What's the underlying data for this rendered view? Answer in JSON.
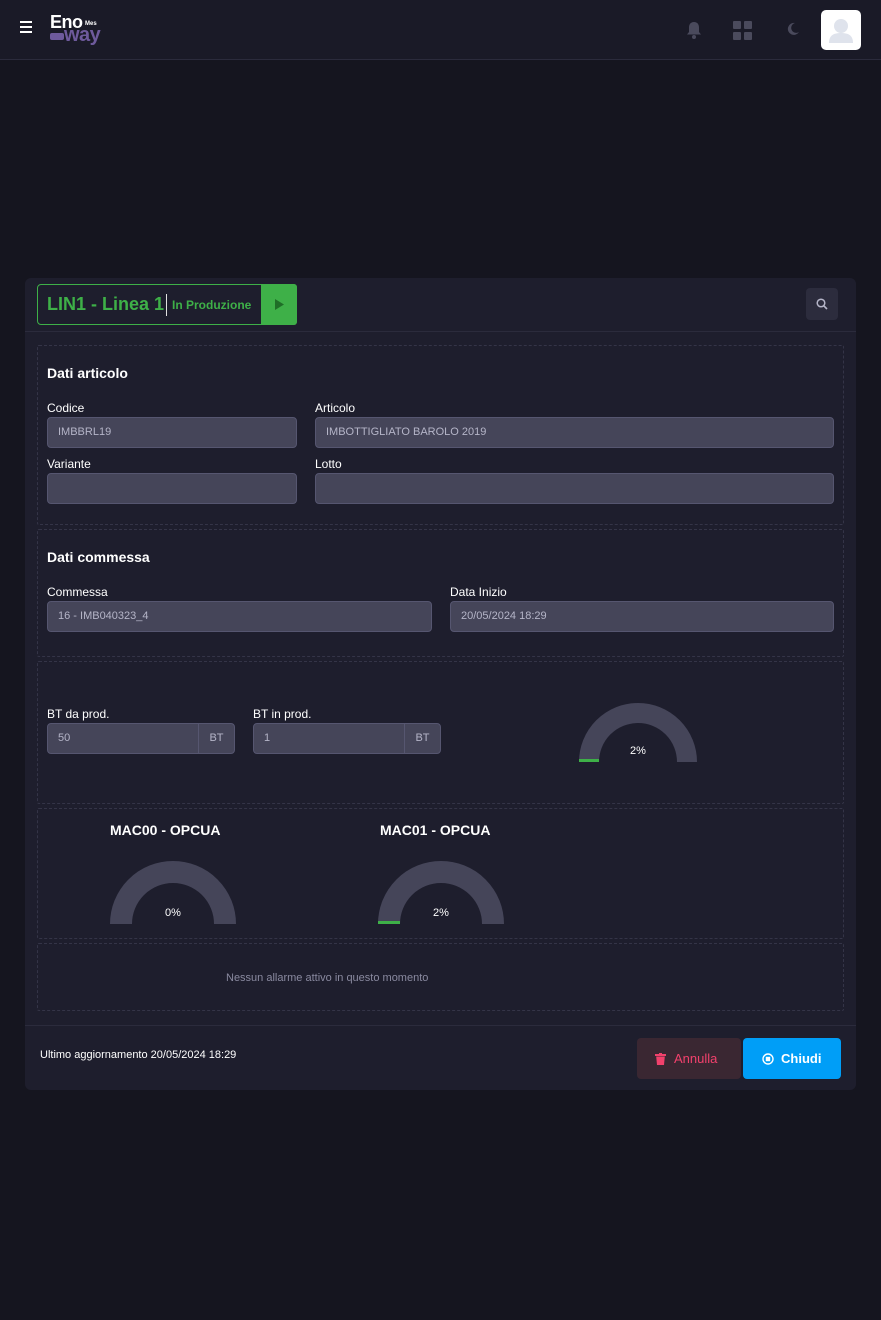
{
  "app": {
    "logo_main": "Eno",
    "logo_sup": "Mes",
    "logo_sub": "way"
  },
  "line": {
    "title": "LIN1 - Linea 1",
    "status": "In Produzione",
    "status_color": "#3eb048"
  },
  "articolo": {
    "section_title": "Dati articolo",
    "codice_label": "Codice",
    "codice_value": "IMBBRL19",
    "articolo_label": "Articolo",
    "articolo_value": "IMBOTTIGLIATO BAROLO 2019",
    "variante_label": "Variante",
    "variante_value": "",
    "lotto_label": "Lotto",
    "lotto_value": ""
  },
  "commessa": {
    "section_title": "Dati commessa",
    "commessa_label": "Commessa",
    "commessa_value": "16 - IMB040323_4",
    "data_inizio_label": "Data Inizio",
    "data_inizio_value": "20/05/2024 18:29"
  },
  "produzione": {
    "bt_da_prod_label": "BT da prod.",
    "bt_da_prod_value": "50",
    "bt_da_prod_unit": "BT",
    "bt_in_prod_label": "BT in prod.",
    "bt_in_prod_value": "1",
    "bt_in_prod_unit": "BT",
    "gauge_label": "2%",
    "gauge_fraction": 0.02
  },
  "machines": [
    {
      "title": "MAC00 - OPCUA",
      "gauge_label": "0%",
      "gauge_fraction": 0.0
    },
    {
      "title": "MAC01 - OPCUA",
      "gauge_label": "2%",
      "gauge_fraction": 0.02
    }
  ],
  "alarms": {
    "message": "Nessun allarme attivo in questo momento"
  },
  "footer": {
    "last_update": "Ultimo aggiornamento 20/05/2024 18:29",
    "annulla_label": "Annulla",
    "chiudi_label": "Chiudi"
  },
  "colors": {
    "accent_green": "#3eb048",
    "danger": "#f1416c",
    "primary": "#009ef7",
    "gauge_track": "#454559"
  }
}
